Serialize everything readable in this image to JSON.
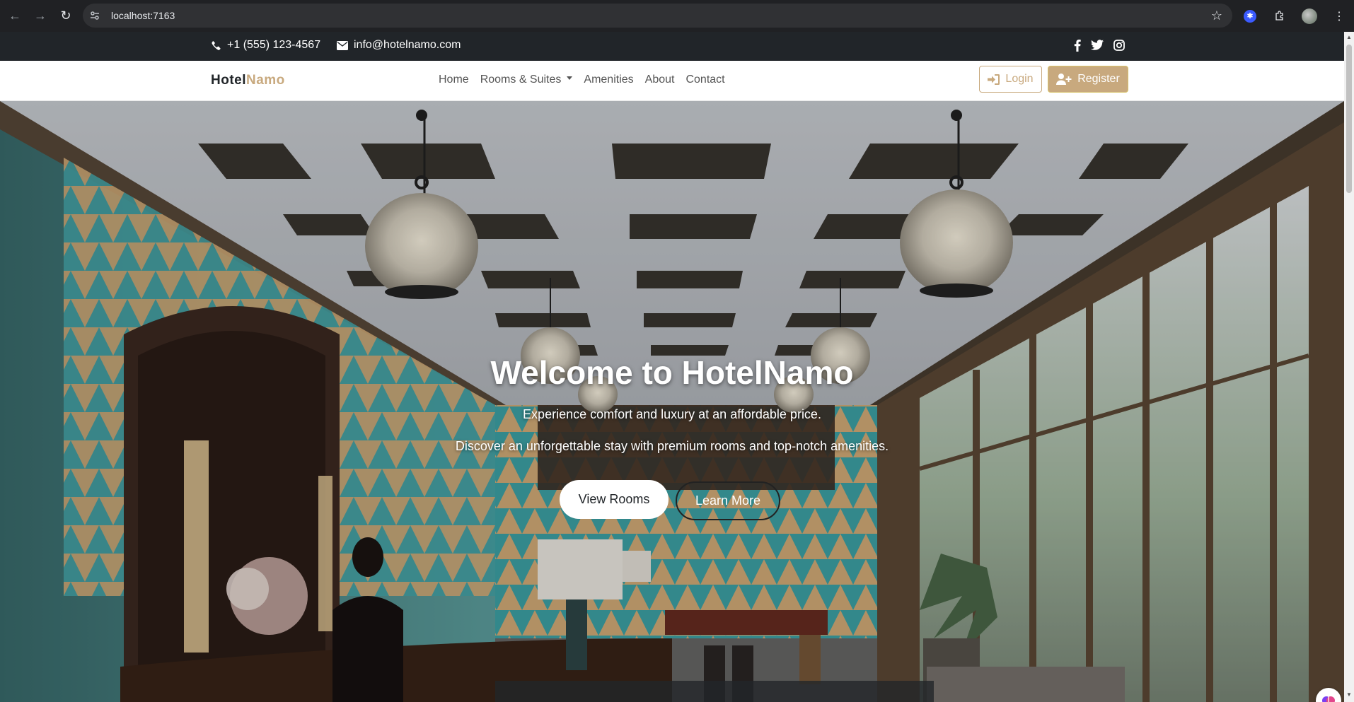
{
  "browser": {
    "url": "localhost:7163"
  },
  "topbar": {
    "phone": "+1 (555) 123-4567",
    "email": "info@hotelnamo.com",
    "social": [
      "facebook-icon",
      "twitter-icon",
      "instagram-icon"
    ]
  },
  "navbar": {
    "brand_part1": "Hotel",
    "brand_part2": "Namo",
    "menu": {
      "home": "Home",
      "rooms": "Rooms & Suites",
      "amenities": "Amenities",
      "about": "About",
      "contact": "Contact"
    },
    "login": "Login",
    "register": "Register"
  },
  "hero": {
    "title": "Welcome to HotelNamo",
    "subtitle": "Experience comfort and luxury at an affordable price.",
    "description": "Discover an unforgettable stay with premium rooms and top-notch amenities.",
    "view_rooms": "View Rooms",
    "learn_more": "Learn More"
  },
  "colors": {
    "accent": "#c8a97e",
    "topbar_bg": "#212529",
    "chrome_bg": "#202124"
  }
}
